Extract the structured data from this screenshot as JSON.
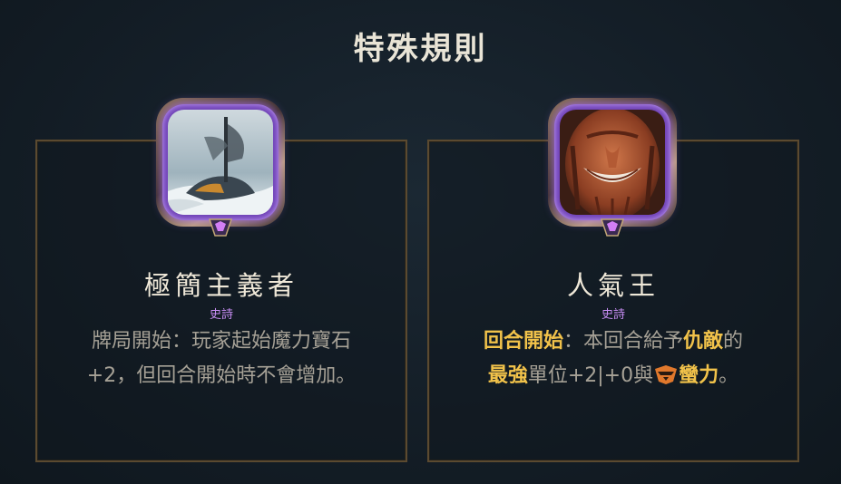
{
  "header": {
    "title": "特殊規則"
  },
  "cards": [
    {
      "name": "極簡主義者",
      "rarity": "史詩",
      "description": {
        "line1": "牌局開始：玩家起始魔力寶石",
        "line2": "+2，但回合開始時不會增加。"
      },
      "icon": "shipwreck-portrait"
    },
    {
      "name": "人氣王",
      "rarity": "史詩",
      "description": {
        "hl_start": "回合開始",
        "text1": "：本回合給予",
        "hl_enemy": "仇敵",
        "text2": "的",
        "hl_strongest": "最強",
        "text3": "單位+2|+0與",
        "hl_keyword": "蠻力",
        "text4": "。"
      },
      "icon": "grinning-champion-portrait",
      "keyword_icon": "overwhelm-icon"
    }
  ],
  "colors": {
    "highlight": "#f1c24a",
    "rarity_epic": "#c88ef5",
    "frame_purple": "#6c3fb4",
    "border_gold": "#5b4a30"
  }
}
